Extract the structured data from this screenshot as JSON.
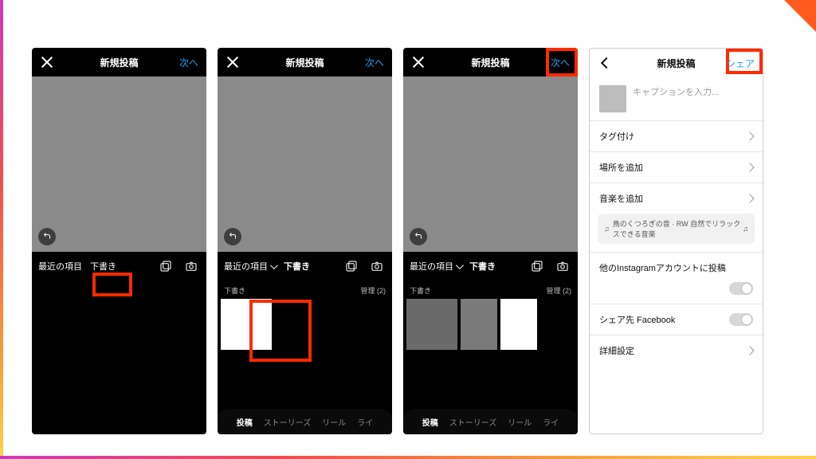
{
  "colors": {
    "accent": "#1ea1f2",
    "highlight": "#ff2a00"
  },
  "header": {
    "title": "新規投稿",
    "next": "次へ",
    "share": "シェア"
  },
  "tabrow": {
    "recent": "最近の項目",
    "draft": "下書き"
  },
  "drafts": {
    "label": "下書き",
    "manage": "管理 (2)"
  },
  "bottom": {
    "post": "投稿",
    "stories": "ストーリーズ",
    "reels": "リール",
    "live": "ライ"
  },
  "share_sheet": {
    "caption_placeholder": "キャプションを入力...",
    "tag_people": "タグ付け",
    "add_location": "場所を追加",
    "add_music": "音楽を追加",
    "music_suggestion": "鳥のくつろぎの音 · RW 自然でリラックスできる音楽",
    "other_accounts": "他のInstagramアカウントに投稿",
    "share_fb": "シェア先 Facebook",
    "advanced": "詳細設定"
  }
}
